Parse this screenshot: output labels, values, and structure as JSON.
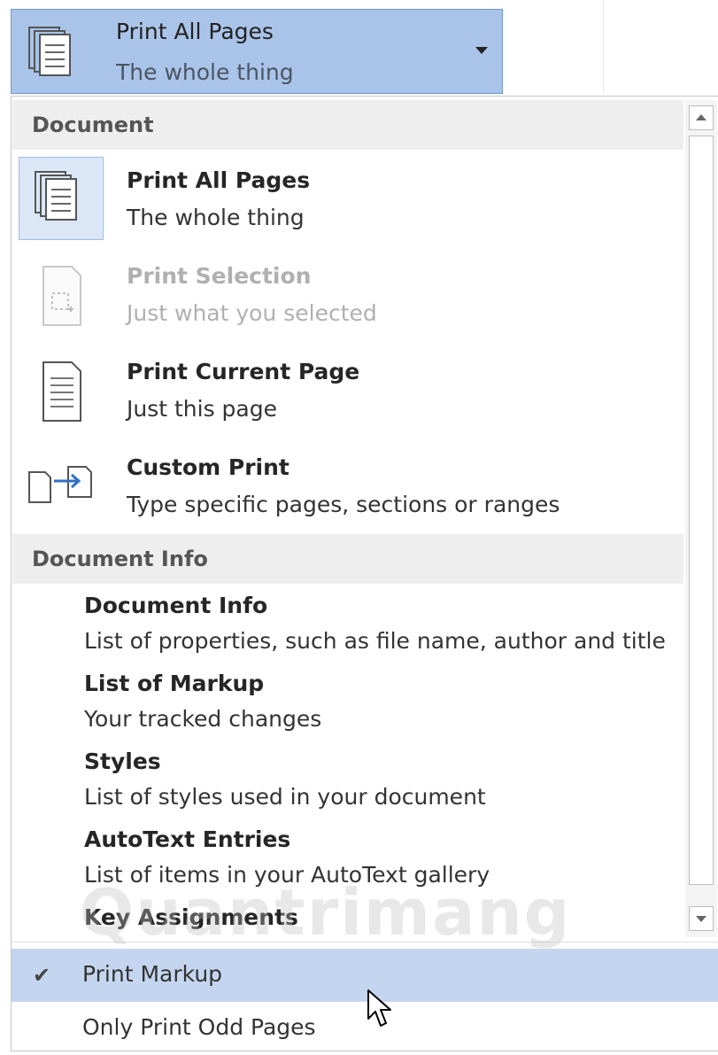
{
  "combo": {
    "title": "Print All Pages",
    "subtitle": "The whole thing"
  },
  "sections": {
    "document": {
      "header": "Document"
    },
    "info": {
      "header": "Document Info"
    }
  },
  "items": [
    {
      "title": "Print All Pages",
      "desc": "The whole thing",
      "icon": "pages-stack-icon",
      "selected": true
    },
    {
      "title": "Print Selection",
      "desc": "Just what you selected",
      "icon": "selection-page-icon",
      "disabled": true
    },
    {
      "title": "Print Current Page",
      "desc": "Just this page",
      "icon": "single-page-icon"
    },
    {
      "title": "Custom Print",
      "desc": "Type specific pages, sections or ranges",
      "icon": "custom-print-icon"
    }
  ],
  "info_items": [
    {
      "title": "Document Info",
      "desc": "List of properties, such as file name, author and title"
    },
    {
      "title": "List of Markup",
      "desc": "Your tracked changes"
    },
    {
      "title": "Styles",
      "desc": "List of styles used in your document"
    },
    {
      "title": "AutoText Entries",
      "desc": "List of items in your AutoText gallery"
    },
    {
      "title": "Key Assignments",
      "desc": ""
    }
  ],
  "options": [
    {
      "label": "Print Markup",
      "checked": "✔"
    },
    {
      "label": "Only Print Odd Pages"
    }
  ],
  "watermark": "Quantrimang",
  "colors": {
    "selected_bg": "#dbe7f7",
    "hover_bg": "#c4d6ef",
    "combo_bg": "#a9c4e8"
  }
}
